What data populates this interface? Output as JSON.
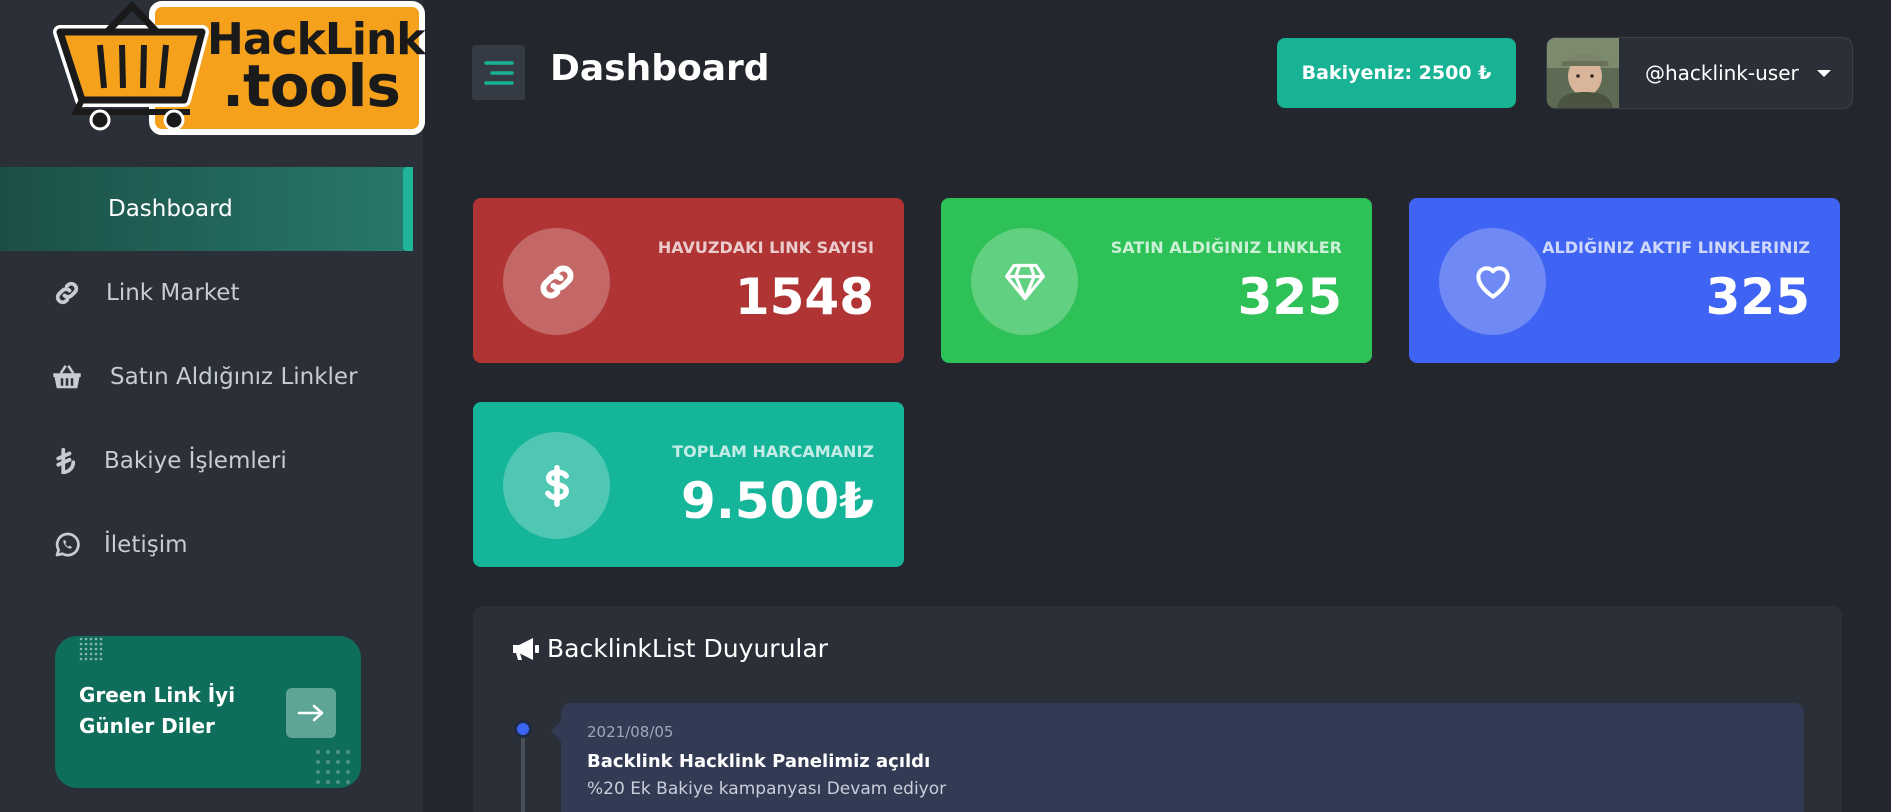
{
  "brand": {
    "logo_line1": "HackLink",
    "logo_line2": ".tools"
  },
  "sidebar": {
    "items": [
      {
        "label": "Dashboard",
        "icon": "none",
        "active": true
      },
      {
        "label": "Link Market",
        "icon": "link-icon"
      },
      {
        "label": "Satın Aldığınız Linkler",
        "icon": "basket-icon"
      },
      {
        "label": "Bakiye İşlemleri",
        "icon": "lira-icon"
      },
      {
        "label": "İletişim",
        "icon": "whatsapp-icon"
      }
    ],
    "promo": {
      "text": "Green Link İyi Günler Diler",
      "arrow_icon": "arrow-right-icon"
    }
  },
  "header": {
    "title": "Dashboard",
    "balance_label": "Bakiyeniz: 2500 ₺",
    "username": "@hacklink-user"
  },
  "stats": [
    {
      "label": "HAVUZDAKI LINK SAYISI",
      "value": "1548",
      "color": "#b03434",
      "icon": "link-icon"
    },
    {
      "label": "SATIN ALDIĞINIZ LINKLER",
      "value": "325",
      "color": "#2ec157",
      "icon": "diamond-icon"
    },
    {
      "label": "ALDIĞINIZ AKTIF LINKLERINIZ",
      "value": "325",
      "color": "#3f63f2",
      "icon": "heart-icon"
    },
    {
      "label": "TOPLAM HARCAMANIZ",
      "value": "9.500₺",
      "color": "#15b59a",
      "icon": "dollar-icon"
    }
  ],
  "announcements": {
    "title": "BacklinkList Duyurular",
    "items": [
      {
        "date": "2021/08/05",
        "title": "Backlink Hacklink Panelimiz açıldı",
        "body": "%20 Ek Bakiye kampanyası Devam ediyor"
      }
    ]
  },
  "colors": {
    "accent": "#17b394",
    "background": "#23272d",
    "sidebar": "#2b3038"
  }
}
